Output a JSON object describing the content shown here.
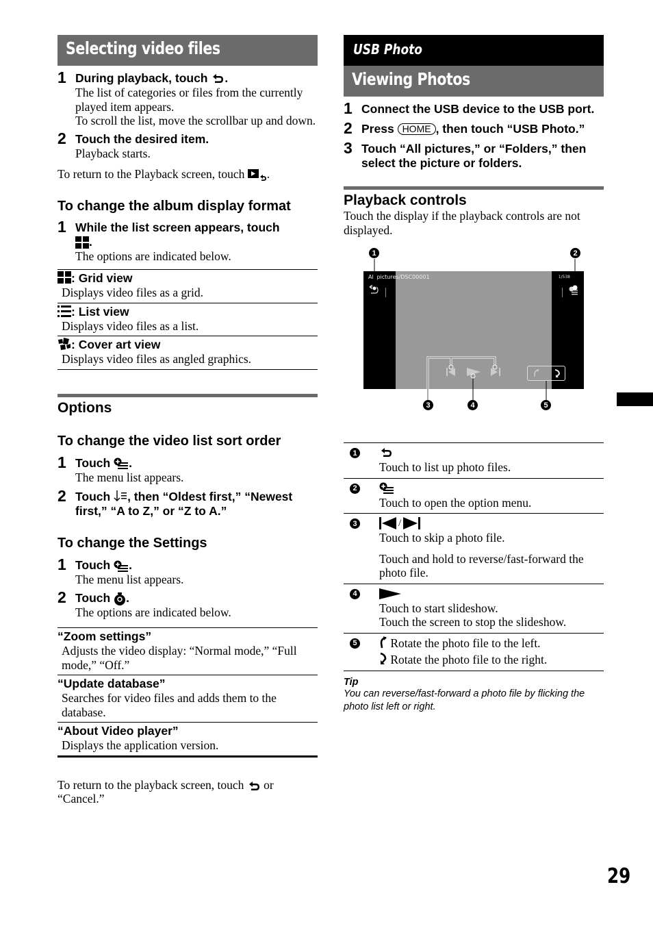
{
  "left": {
    "section_title": "Selecting video files",
    "steps": [
      {
        "num": "1",
        "head_pre": "During playback, touch",
        "head_post": ".",
        "icon": "back-arrow-icon",
        "body": [
          "The list of categories or files from the currently played item appears.",
          "To scroll the list, move the scrollbar up and down."
        ]
      },
      {
        "num": "2",
        "head": "Touch the desired item.",
        "body": [
          "Playback starts."
        ]
      }
    ],
    "return_text": "To return to the Playback screen, touch",
    "return_icon": "playback-return-icon",
    "album_format": {
      "title": "To change the album display format",
      "step": {
        "num": "1",
        "head": "While the list screen appears, touch",
        "icon": "grid-icon",
        "body": "The options are indicated below."
      },
      "options": [
        {
          "icon": "grid-icon",
          "title": ": Grid view",
          "desc": "Displays video files as a grid."
        },
        {
          "icon": "list-icon",
          "title": ": List view",
          "desc": "Displays video files as a list."
        },
        {
          "icon": "cover-art-icon",
          "title": ": Cover art view",
          "desc": "Displays video files as angled graphics."
        }
      ]
    },
    "options_section": {
      "title": "Options",
      "sort_order": {
        "title": "To change the video list sort order",
        "steps": [
          {
            "num": "1",
            "head": "Touch",
            "icon": "option-menu-icon",
            "body": "The menu list appears."
          },
          {
            "num": "2",
            "head_pre": "Touch",
            "icon": "sort-icon",
            "head_post": ", then “Oldest first,” “Newest first,” “A to Z,” or “Z to A.”"
          }
        ]
      },
      "settings": {
        "title": "To change the Settings",
        "steps": [
          {
            "num": "1",
            "head": "Touch",
            "icon": "option-menu-icon",
            "body": "The menu list appears."
          },
          {
            "num": "2",
            "head": "Touch",
            "icon": "settings-gear-icon",
            "body": "The options are indicated below."
          }
        ],
        "options": [
          {
            "title": "“Zoom settings”",
            "desc": "Adjusts the video display: “Normal mode,” “Full mode,” “Off.”"
          },
          {
            "title": "“Update database”",
            "desc": "Searches for video files and adds them to the database."
          },
          {
            "title": "“About Video player”",
            "desc": "Displays the application version."
          }
        ]
      },
      "return_pre": "To return to the playback screen, touch",
      "return_post": "or “Cancel.”"
    }
  },
  "right": {
    "category_title": "USB Photo",
    "section_title": "Viewing Photos",
    "steps": [
      {
        "num": "1",
        "head": "Connect the USB device to the USB port."
      },
      {
        "num": "2",
        "head_pre": "Press",
        "key": "HOME",
        "head_post": ", then touch “USB Photo.”"
      },
      {
        "num": "3",
        "head": "Touch “All pictures,” or “Folders,” then select the picture or folders."
      }
    ],
    "playback": {
      "title": "Playback controls",
      "intro": "Touch the display if the playback controls are not displayed.",
      "screen": {
        "path": "All pictures/DSC00001",
        "count": "1/538"
      },
      "callouts": [
        "1",
        "2",
        "3",
        "4",
        "5"
      ],
      "rows": [
        {
          "callout": "1",
          "icon": "back-arrow-icon",
          "desc": [
            "Touch to list up photo files."
          ]
        },
        {
          "callout": "2",
          "icon": "option-menu-icon",
          "desc": [
            "Touch to open the option menu."
          ]
        },
        {
          "callout": "3",
          "icon": "skip-prev-next-icon",
          "separator": "/",
          "desc": [
            "Touch to skip a photo file.",
            "Touch and hold to reverse/fast-forward the photo file."
          ]
        },
        {
          "callout": "4",
          "icon": "play-icon",
          "desc": [
            "Touch to start slideshow.",
            "Touch the screen to stop the slideshow."
          ]
        },
        {
          "callout": "5",
          "rotations": [
            {
              "icon": "rotate-left-icon",
              "desc": "Rotate the photo file to the left."
            },
            {
              "icon": "rotate-right-icon",
              "desc": "Rotate the photo file to the right."
            }
          ]
        }
      ],
      "tip_title": "Tip",
      "tip_body": "You can reverse/fast-forward a photo file by flicking the photo list left or right."
    }
  },
  "page_number": "29"
}
